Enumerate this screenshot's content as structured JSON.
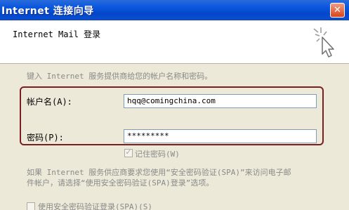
{
  "window": {
    "title": "Internet 连接向导",
    "close_glyph": "✕"
  },
  "header": {
    "title": "Internet Mail 登录",
    "icon": "wizard-sparkle-cursor-icon"
  },
  "content": {
    "intro": "键入 Internet 服务提供商给您的帐户名称和密码。",
    "account_label": "帐户名(A):",
    "account_value": "hqq@comingchina.com",
    "password_label": "密码(P):",
    "password_value": "*********",
    "remember_label": "记住密码(W)",
    "remember_checked": true,
    "spa_note_line1": "如果 Internet 服务供应商要求您使用“安全密码验证(SPA)”来访问电子邮",
    "spa_note_line2": "件帐户，请选择“使用安全密码验证(SPA)登录”选项。",
    "spa_checkbox_label": "使用安全密码验证登录(SPA)(S)",
    "spa_checked": false
  },
  "colors": {
    "titlebar": "#0a58e0",
    "highlight_border": "#7a1f1f",
    "disabled_text": "#8a8a8a"
  }
}
